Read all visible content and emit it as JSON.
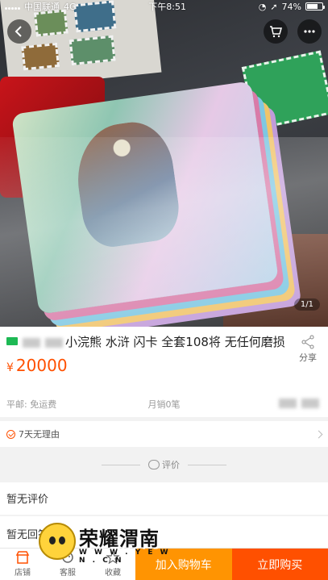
{
  "status_bar": {
    "carrier": "中国联通",
    "network": "4G",
    "time": "下午8:51",
    "battery": "74%"
  },
  "gallery": {
    "counter": "1/1",
    "battery_level": 0.74
  },
  "product": {
    "title": "小浣熊 水浒 闪卡 全套108将 无任何磨损",
    "currency": "¥",
    "price": "20000",
    "shipping": "平邮: 免运费",
    "monthly_sales": "月销0笔"
  },
  "share": {
    "label": "分享"
  },
  "service": {
    "label": "7天无理由"
  },
  "reviews": {
    "divider_label": "评价",
    "empty_text": "暂无评价",
    "qa_text": "暂无回答"
  },
  "watermark": {
    "text": "荣耀渭南",
    "url": "W W W . Y E W N . C N"
  },
  "bottom_bar": {
    "shop": "店铺",
    "service": "客服",
    "favorite": "收藏",
    "add_to_cart": "加入购物车",
    "buy_now": "立即购买"
  },
  "colors": {
    "price": "#ff5000",
    "add_to_cart": "#ff9402",
    "buy_now": "#ff5000"
  }
}
